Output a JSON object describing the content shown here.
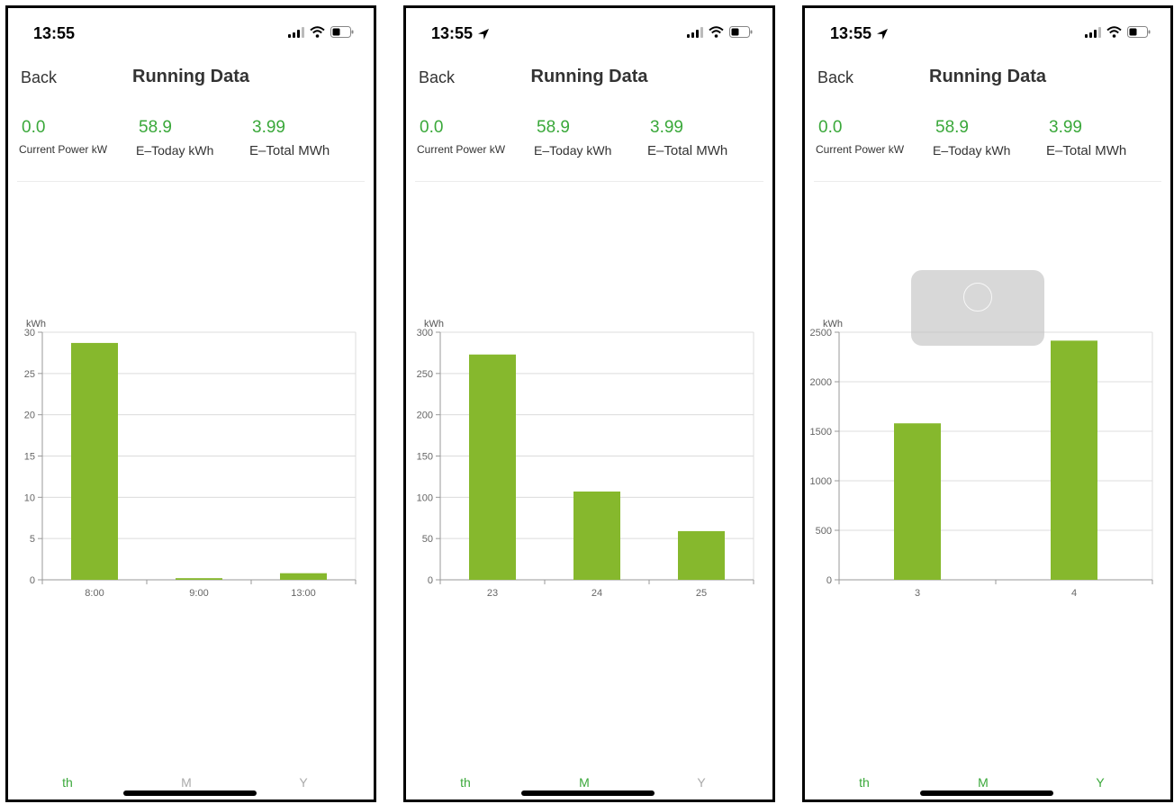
{
  "colors": {
    "accent": "#3aa83a",
    "bar": "#86b82d",
    "grid": "#dcdcdc"
  },
  "phones": [
    {
      "time": "13:55",
      "show_location": false,
      "back_label": "Back",
      "title": "Running Data",
      "stats": [
        {
          "value": "0.0",
          "label": "Current Power kW"
        },
        {
          "value": "58.9",
          "label": "E–Today kWh"
        },
        {
          "value": "3.99",
          "label": "E–Total MWh"
        }
      ],
      "tabs": [
        {
          "label": "th",
          "active": true
        },
        {
          "label": "M",
          "active": false
        },
        {
          "label": "Y",
          "active": false
        }
      ],
      "selected_tab": 0,
      "show_toast": false
    },
    {
      "time": "13:55",
      "show_location": true,
      "back_label": "Back",
      "title": "Running Data",
      "stats": [
        {
          "value": "0.0",
          "label": "Current Power kW"
        },
        {
          "value": "58.9",
          "label": "E–Today kWh"
        },
        {
          "value": "3.99",
          "label": "E–Total MWh"
        }
      ],
      "tabs": [
        {
          "label": "th",
          "active": true
        },
        {
          "label": "M",
          "active": true
        },
        {
          "label": "Y",
          "active": false
        }
      ],
      "selected_tab": 1,
      "show_toast": false
    },
    {
      "time": "13:55",
      "show_location": true,
      "back_label": "Back",
      "title": "Running Data",
      "stats": [
        {
          "value": "0.0",
          "label": "Current Power kW"
        },
        {
          "value": "58.9",
          "label": "E–Today kWh"
        },
        {
          "value": "3.99",
          "label": "E–Total MWh"
        }
      ],
      "tabs": [
        {
          "label": "th",
          "active": true
        },
        {
          "label": "M",
          "active": true
        },
        {
          "label": "Y",
          "active": true
        }
      ],
      "selected_tab": 2,
      "show_toast": true
    }
  ],
  "chart_data": [
    {
      "type": "bar",
      "ylabel": "kWh",
      "categories": [
        "8:00",
        "9:00",
        "13:00"
      ],
      "values": [
        28.7,
        0.2,
        0.8
      ],
      "ylim": [
        0,
        30
      ],
      "yticks": [
        0,
        5,
        10,
        15,
        20,
        25,
        30
      ],
      "grid": true
    },
    {
      "type": "bar",
      "ylabel": "kWh",
      "categories": [
        "23",
        "24",
        "25"
      ],
      "values": [
        273,
        107,
        59
      ],
      "ylim": [
        0,
        300
      ],
      "yticks": [
        0,
        50,
        100,
        150,
        200,
        250,
        300
      ],
      "grid": true
    },
    {
      "type": "bar",
      "ylabel": "kWh",
      "categories": [
        "3",
        "4"
      ],
      "values": [
        1580,
        2415
      ],
      "ylim": [
        0,
        2500
      ],
      "yticks": [
        0,
        500,
        1000,
        1500,
        2000,
        2500
      ],
      "grid": true
    }
  ]
}
